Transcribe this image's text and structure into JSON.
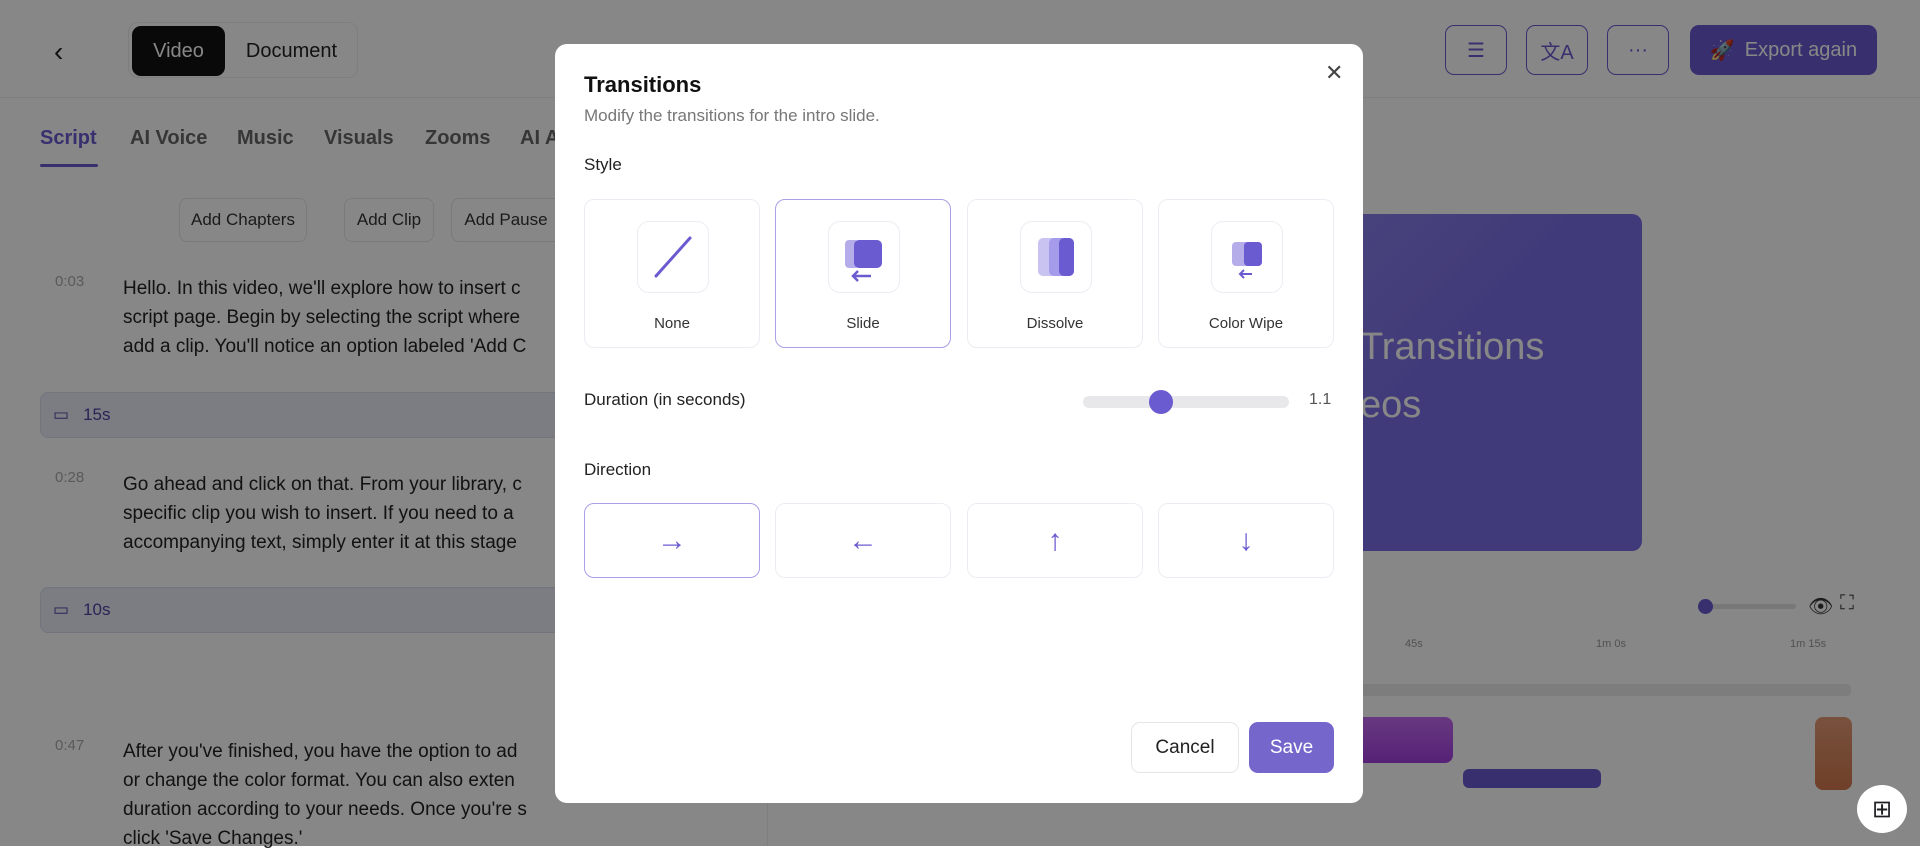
{
  "header": {
    "back_icon": "chevron-left-icon",
    "mode_toggle": [
      "Video",
      "Document"
    ],
    "active_mode": "Video",
    "export_label": "Export again",
    "icons": [
      "sliders-icon",
      "translate-icon",
      "more-icon",
      "rocket-icon"
    ]
  },
  "tabs": [
    "Script",
    "AI Voice",
    "Music",
    "Visuals",
    "Zooms",
    "AI A"
  ],
  "actions": [
    "Add Chapters",
    "Add Clip",
    "Add Pause"
  ],
  "script": [
    {
      "time": "0:03",
      "lines": [
        "Hello. In this video, we'll explore how to insert c",
        "script page. Begin by selecting the script where",
        "add a clip. You'll notice an option labeled 'Add C"
      ]
    },
    {
      "clip": "15s"
    },
    {
      "time": "0:28",
      "lines": [
        "Go ahead and click on that. From your library, c",
        "specific clip you wish to insert. If you need to a",
        "accompanying text, simply enter it at this stage"
      ]
    },
    {
      "clip": "10s"
    },
    {
      "time": "0:47",
      "lines": [
        "After you've finished, you have the option to ad",
        "or change the color format. You can also exten",
        "duration according to your needs. Once you're s",
        "click 'Save Changes.'"
      ]
    }
  ],
  "preview": {
    "line1": "Transitions",
    "line2": "eos"
  },
  "timeline": {
    "ticks": [
      "45s",
      "1m 0s",
      "1m 15s"
    ],
    "zoom_fraction": 0.0
  },
  "modal": {
    "title": "Transitions",
    "subtitle": "Modify the transitions for the intro slide.",
    "style_label": "Style",
    "styles": [
      {
        "label": "None"
      },
      {
        "label": "Slide"
      },
      {
        "label": "Dissolve"
      },
      {
        "label": "Color Wipe"
      }
    ],
    "selected_style": "Slide",
    "duration_label": "Duration (in seconds)",
    "duration_value": "1.1",
    "duration_fraction": 0.38,
    "direction_label": "Direction",
    "directions": [
      "→",
      "←",
      "↑",
      "↓"
    ],
    "selected_direction": "→",
    "cancel": "Cancel",
    "save": "Save"
  },
  "colors": {
    "accent": "#6b5bd0",
    "overlay": "rgba(0,0,0,0.47)"
  }
}
